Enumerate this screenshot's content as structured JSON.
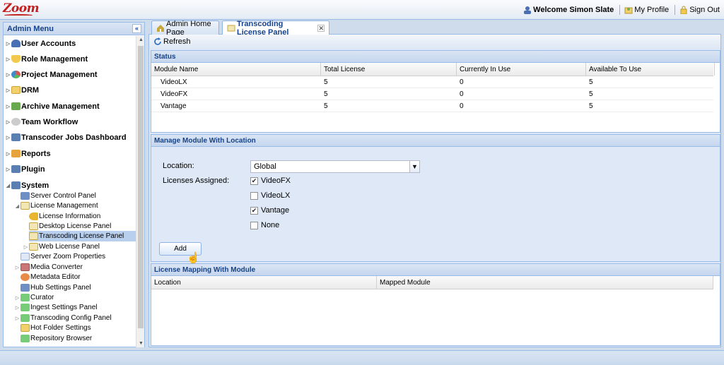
{
  "header": {
    "logo": "Zoom",
    "welcome": "Welcome Simon Slate",
    "my_profile": "My Profile",
    "sign_out": "Sign Out"
  },
  "sidebar": {
    "title": "Admin Menu",
    "items": [
      {
        "label": "User Accounts",
        "icon": "users-icon",
        "color": "#4a6fb5"
      },
      {
        "label": "Role Management",
        "icon": "shield-icon",
        "color": "#f2c94c"
      },
      {
        "label": "Project Management",
        "icon": "pie-chart-icon",
        "color": "#d9534f"
      },
      {
        "label": "DRM",
        "icon": "folder-icon",
        "color": "#f2d06b"
      },
      {
        "label": "Archive Management",
        "icon": "archive-icon",
        "color": "#6aa84f"
      },
      {
        "label": "Team Workflow",
        "icon": "workflow-icon",
        "color": "#bbbbbb"
      },
      {
        "label": "Transcoder Jobs Dashboard",
        "icon": "computer-icon",
        "color": "#5b7fb0"
      },
      {
        "label": "Reports",
        "icon": "reports-icon",
        "color": "#e6a23c"
      },
      {
        "label": "Plugin",
        "icon": "computer-icon",
        "color": "#5b7fb0"
      },
      {
        "label": "System",
        "icon": "computer-icon",
        "color": "#5b7fb0"
      }
    ],
    "system_children": [
      {
        "label": "Server Control Panel",
        "icon": "monitor-icon"
      },
      {
        "label": "License Management",
        "icon": "license-icon"
      },
      {
        "label": "License Information",
        "icon": "key-icon"
      },
      {
        "label": "Desktop License Panel",
        "icon": "license-icon"
      },
      {
        "label": "Transcoding License Panel",
        "icon": "license-icon"
      },
      {
        "label": "Web License Panel",
        "icon": "license-icon"
      },
      {
        "label": "Server Zoom Properties",
        "icon": "document-icon"
      },
      {
        "label": "Media Converter",
        "icon": "media-icon"
      },
      {
        "label": "Metadata Editor",
        "icon": "editor-icon"
      },
      {
        "label": "Hub Settings Panel",
        "icon": "monitor-icon"
      },
      {
        "label": "Curator",
        "icon": "network-icon"
      },
      {
        "label": "Ingest Settings Panel",
        "icon": "network-icon"
      },
      {
        "label": "Transcoding Config Panel",
        "icon": "network-icon"
      },
      {
        "label": "Hot Folder Settings",
        "icon": "folder-icon"
      },
      {
        "label": "Repository Browser",
        "icon": "network-icon"
      }
    ]
  },
  "tabs": [
    {
      "label": "Admin Home Page",
      "icon": "home-icon"
    },
    {
      "label": "Transcoding License Panel",
      "icon": "license-icon"
    }
  ],
  "toolbar": {
    "refresh_label": "Refresh"
  },
  "status": {
    "title": "Status",
    "columns": [
      "Module Name",
      "Total License",
      "Currently In Use",
      "Available To Use"
    ],
    "rows": [
      [
        "VideoLX",
        "5",
        "0",
        "5"
      ],
      [
        "VideoFX",
        "5",
        "0",
        "5"
      ],
      [
        "Vantage",
        "5",
        "0",
        "5"
      ]
    ]
  },
  "manage": {
    "title": "Manage Module With Location",
    "location_label": "Location:",
    "location_value": "Global",
    "licenses_label": "Licenses Assigned:",
    "options": [
      {
        "label": "VideoFX",
        "checked": true
      },
      {
        "label": "VideoLX",
        "checked": false
      },
      {
        "label": "Vantage",
        "checked": true
      },
      {
        "label": "None",
        "checked": false
      }
    ],
    "add_label": "Add"
  },
  "mapping": {
    "title": "License Mapping With Module",
    "columns": [
      "Location",
      "Mapped Module"
    ]
  }
}
